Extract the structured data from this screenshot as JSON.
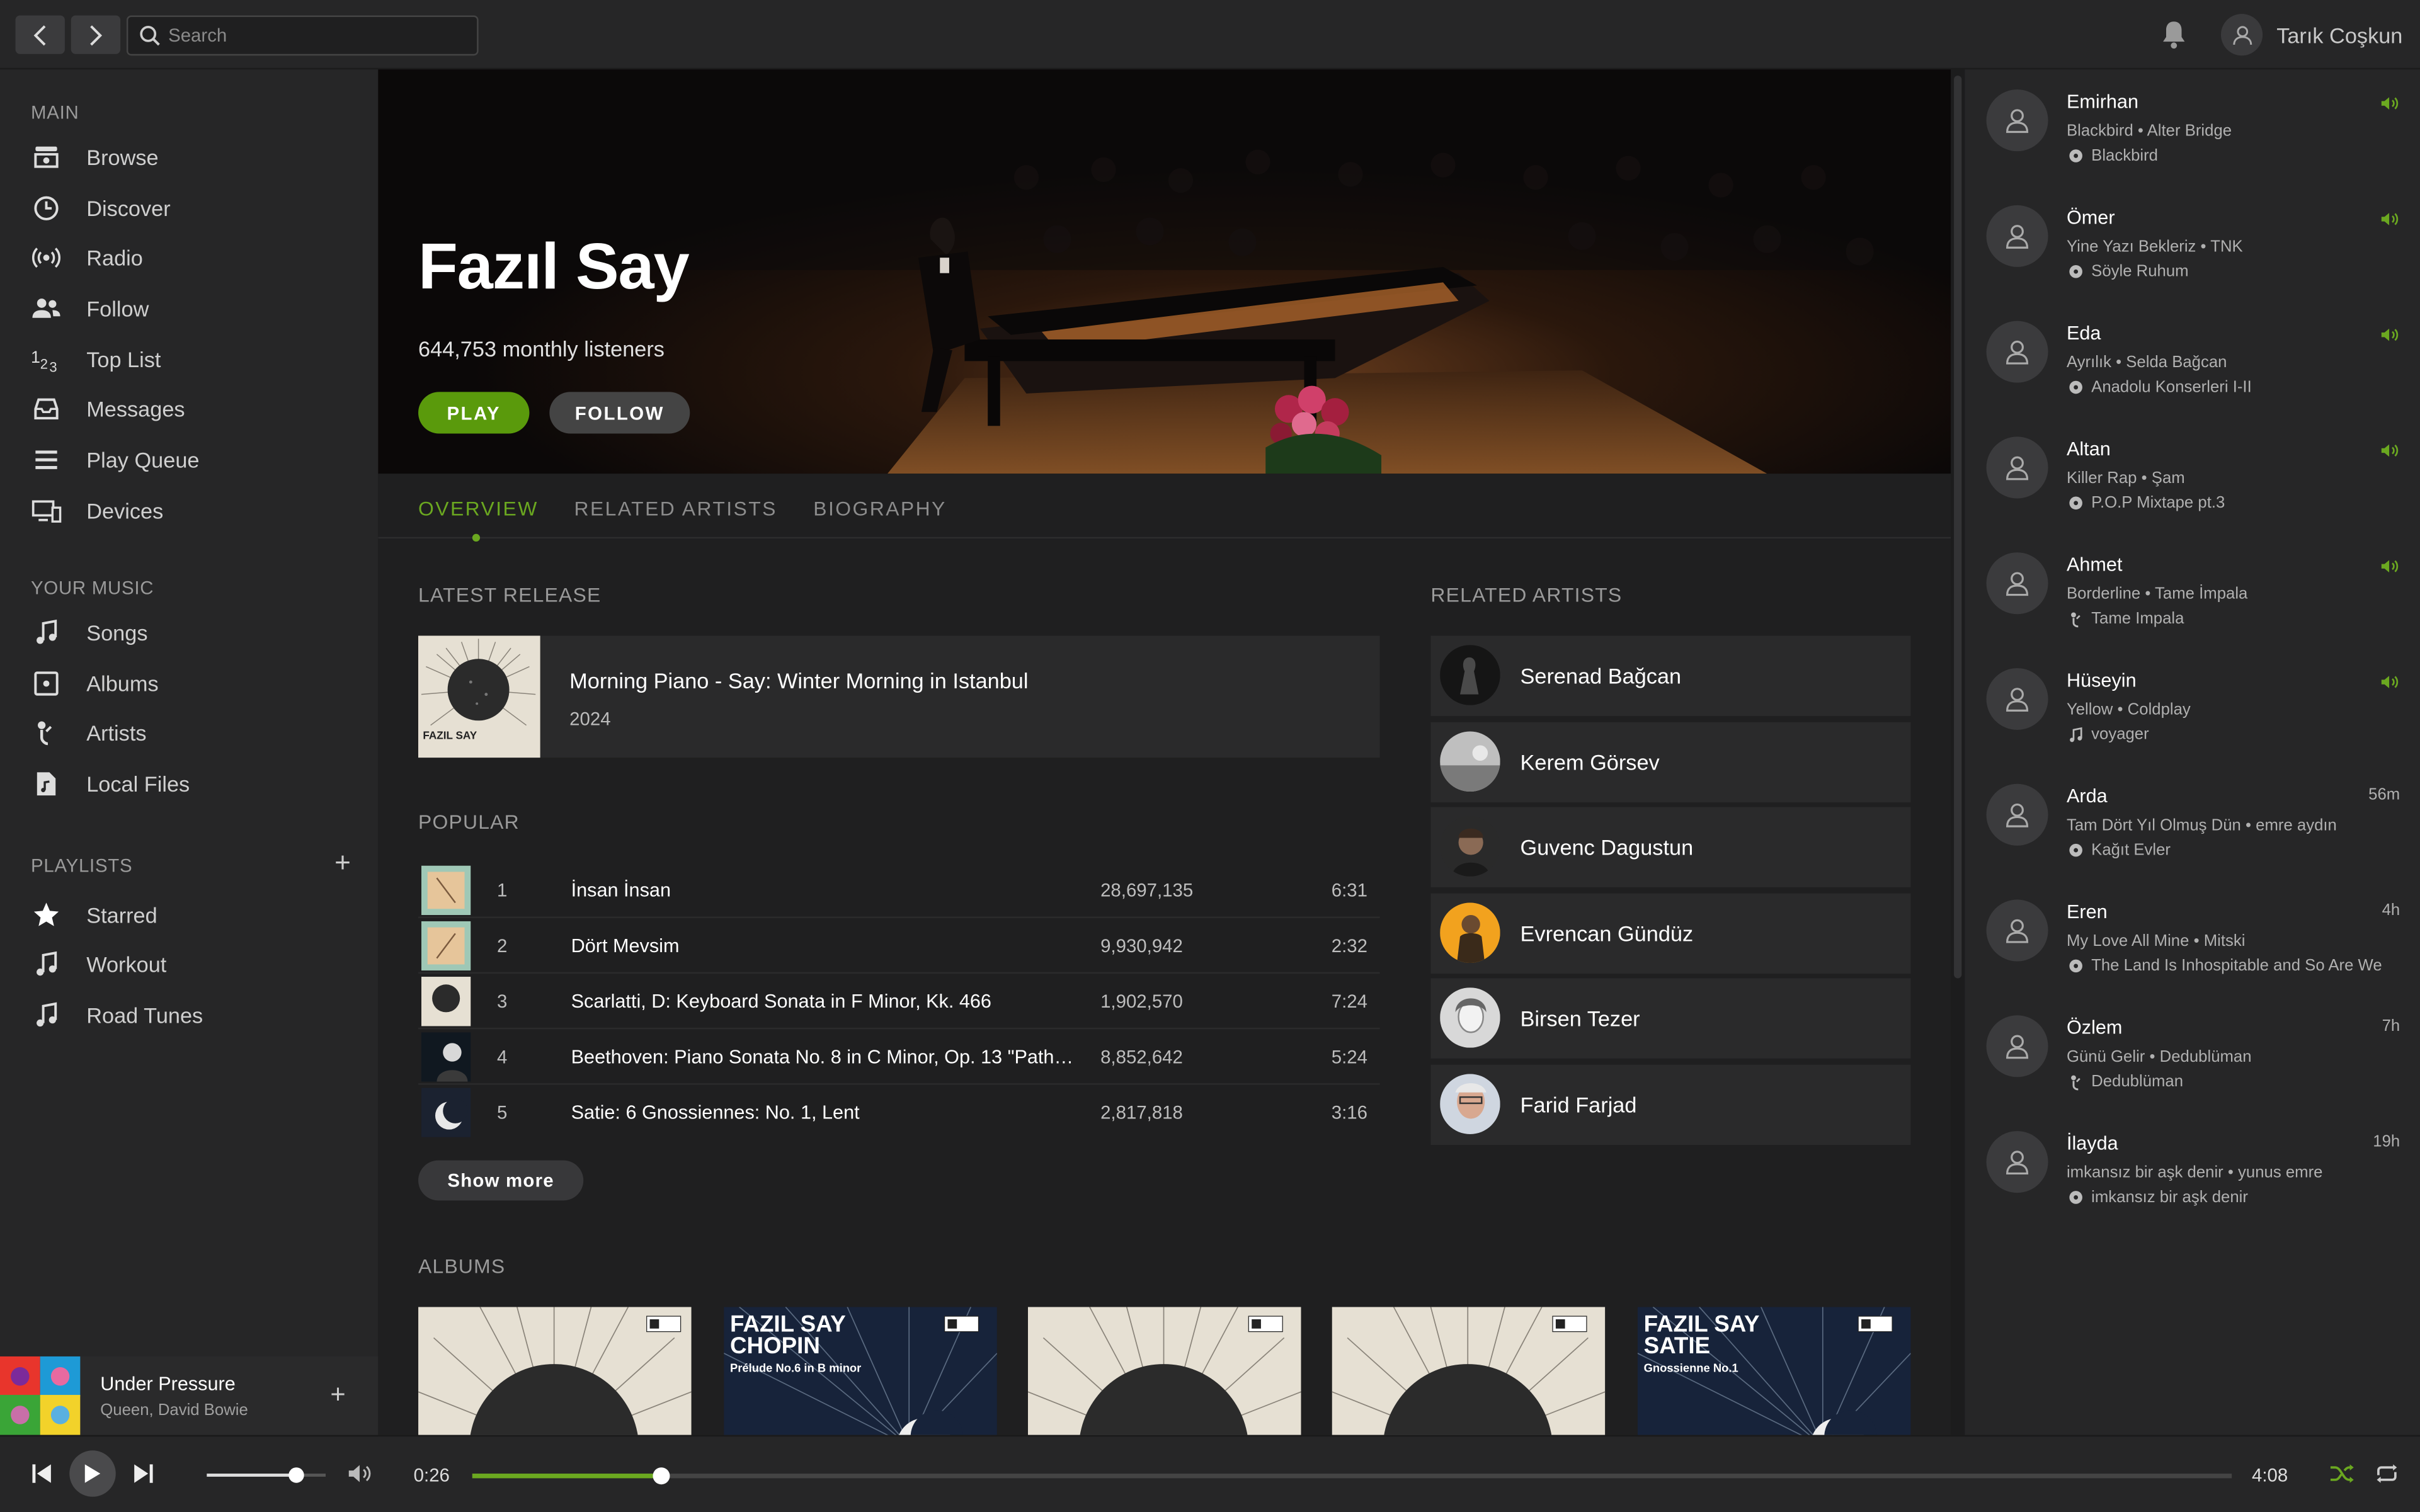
{
  "search": {
    "placeholder": "Search"
  },
  "user": {
    "name": "Tarık Coşkun"
  },
  "sidebar": {
    "main_title": "MAIN",
    "main_items": [
      {
        "label": "Browse",
        "icon": "browse-icon"
      },
      {
        "label": "Discover",
        "icon": "discover-icon"
      },
      {
        "label": "Radio",
        "icon": "radio-icon"
      },
      {
        "label": "Follow",
        "icon": "follow-icon"
      },
      {
        "label": "Top List",
        "icon": "top-list-icon"
      },
      {
        "label": "Messages",
        "icon": "messages-icon"
      },
      {
        "label": "Play Queue",
        "icon": "queue-icon"
      },
      {
        "label": "Devices",
        "icon": "devices-icon"
      }
    ],
    "music_title": "YOUR MUSIC",
    "music_items": [
      {
        "label": "Songs",
        "icon": "music-note-icon"
      },
      {
        "label": "Albums",
        "icon": "album-icon"
      },
      {
        "label": "Artists",
        "icon": "artist-icon"
      },
      {
        "label": "Local Files",
        "icon": "local-file-icon"
      }
    ],
    "playlists_title": "PLAYLISTS",
    "playlists": [
      {
        "label": "Starred",
        "icon": "star-icon"
      },
      {
        "label": "Workout",
        "icon": "music-note-icon"
      },
      {
        "label": "Road Tunes",
        "icon": "music-note-icon"
      }
    ]
  },
  "now_playing": {
    "title": "Under Pressure",
    "artist": "Queen, David Bowie"
  },
  "artist": {
    "name": "Fazıl Say",
    "listeners": "644,753 monthly listeners",
    "play_label": "PLAY",
    "follow_label": "FOLLOW"
  },
  "tabs": [
    {
      "label": "OVERVIEW",
      "active": true
    },
    {
      "label": "RELATED ARTISTS",
      "active": false
    },
    {
      "label": "BIOGRAPHY",
      "active": false
    }
  ],
  "latest_release": {
    "heading": "LATEST RELEASE",
    "title": "Morning Piano - Say: Winter Morning in Istanbul",
    "year": "2024",
    "cover_text": "FAZIL SAY"
  },
  "popular": {
    "heading": "POPULAR",
    "tracks": [
      {
        "num": "1",
        "name": "İnsan İnsan",
        "plays": "28,697,135",
        "duration": "6:31"
      },
      {
        "num": "2",
        "name": "Dört Mevsim",
        "plays": "9,930,942",
        "duration": "2:32"
      },
      {
        "num": "3",
        "name": "Scarlatti, D: Keyboard Sonata in F Minor, Kk. 466",
        "plays": "1,902,570",
        "duration": "7:24"
      },
      {
        "num": "4",
        "name": "Beethoven: Piano Sonata No. 8 in C Minor, Op. 13 \"Pathéti...",
        "plays": "8,852,642",
        "duration": "5:24"
      },
      {
        "num": "5",
        "name": "Satie: 6 Gnossiennes: No. 1, Lent",
        "plays": "2,817,818",
        "duration": "3:16"
      }
    ],
    "show_more": "Show more"
  },
  "related": {
    "heading": "RELATED ARTISTS",
    "artists": [
      "Serenad Bağcan",
      "Kerem Görsev",
      "Guvenc Dagustun",
      "Evrencan Gündüz",
      "Birsen Tezer",
      "Farid Farjad"
    ]
  },
  "albums": {
    "heading": "ALBUMS",
    "items": [
      {
        "title": "",
        "sub": ""
      },
      {
        "title": "FAZIL SAY CHOPIN",
        "sub": "Prélude No.6 in B minor"
      },
      {
        "title": "",
        "sub": ""
      },
      {
        "title": "",
        "sub": ""
      },
      {
        "title": "FAZIL SAY SATIE",
        "sub": "Gnossienne No.1"
      }
    ]
  },
  "friends": [
    {
      "name": "Emirhan",
      "song": "Blackbird • Alter Bridge",
      "context": "Blackbird",
      "ctx_icon": "album-icon",
      "time": "",
      "playing": true
    },
    {
      "name": "Ömer",
      "song": "Yine Yazı Bekleriz • TNK",
      "context": "Söyle Ruhum",
      "ctx_icon": "album-icon",
      "time": "",
      "playing": true
    },
    {
      "name": "Eda",
      "song": "Ayrılık • Selda Bağcan",
      "context": "Anadolu Konserleri I-II",
      "ctx_icon": "album-icon",
      "time": "",
      "playing": true
    },
    {
      "name": "Altan",
      "song": "Killer Rap • Şam",
      "context": "P.O.P Mixtape pt.3",
      "ctx_icon": "album-icon",
      "time": "",
      "playing": true
    },
    {
      "name": "Ahmet",
      "song": "Borderline • Tame İmpala",
      "context": "Tame Impala",
      "ctx_icon": "artist-icon",
      "time": "",
      "playing": true
    },
    {
      "name": "Hüseyin",
      "song": "Yellow • Coldplay",
      "context": "voyager",
      "ctx_icon": "music-note-icon",
      "time": "",
      "playing": true
    },
    {
      "name": "Arda",
      "song": "Tam Dört Yıl Olmuş Dün • emre aydın",
      "context": "Kağıt Evler",
      "ctx_icon": "album-icon",
      "time": "56m",
      "playing": false
    },
    {
      "name": "Eren",
      "song": "My Love All Mine • Mitski",
      "context": "The Land Is Inhospitable and So Are We",
      "ctx_icon": "album-icon",
      "time": "4h",
      "playing": false
    },
    {
      "name": "Özlem",
      "song": "Günü Gelir • Dedublüman",
      "context": "Dedublüman",
      "ctx_icon": "artist-icon",
      "time": "7h",
      "playing": false
    },
    {
      "name": "İlayda",
      "song": "imkansız bir aşk denir • yunus emre",
      "context": "imkansız bir aşk denir",
      "ctx_icon": "album-icon",
      "time": "19h",
      "playing": false
    }
  ],
  "player": {
    "current_time": "0:26",
    "total_time": "4:08",
    "progress": 0.107,
    "volume": 0.75
  },
  "colors": {
    "accent": "#6ba820",
    "play_button": "#5a9a0c",
    "background": "#1f1f20",
    "panel": "#262627"
  }
}
